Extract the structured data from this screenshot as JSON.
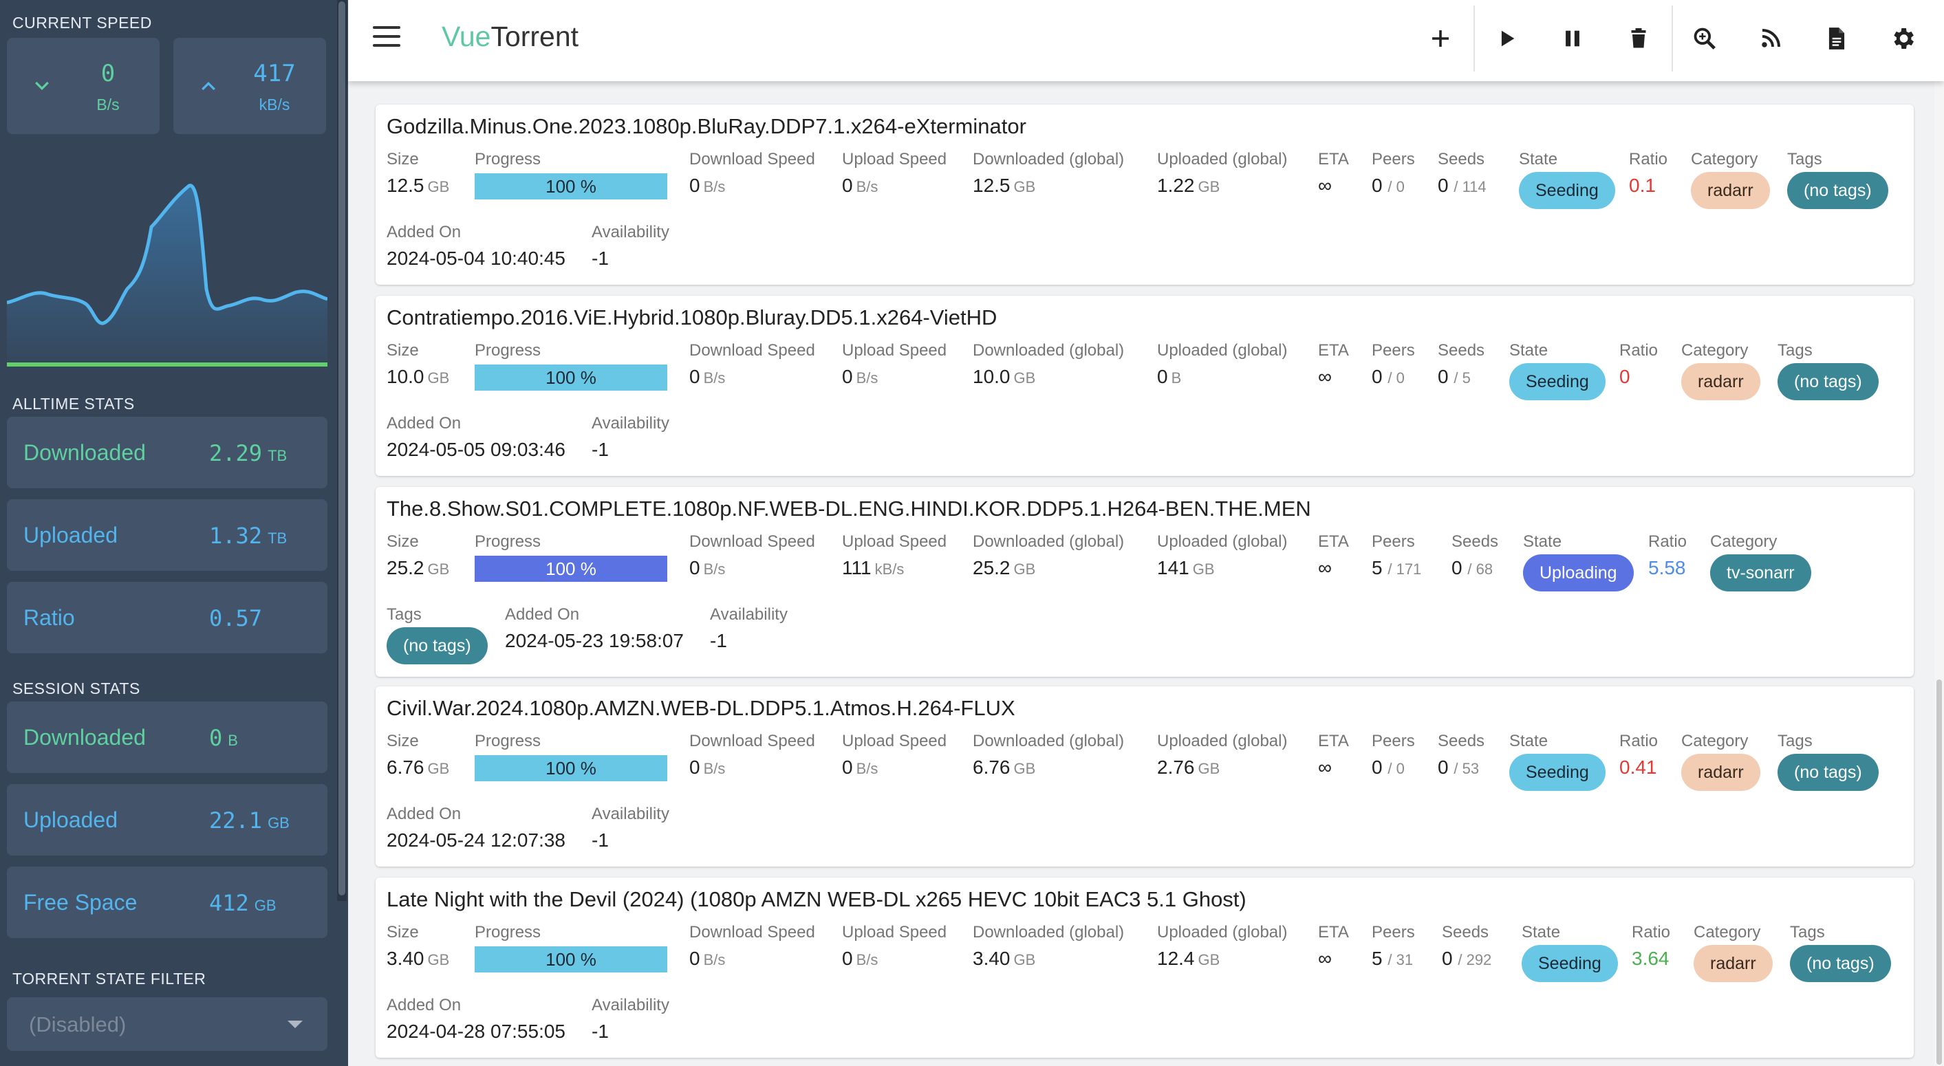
{
  "sidebar": {
    "current_speed_heading": "CURRENT SPEED",
    "download_speed": {
      "value": "0",
      "unit": "B/s"
    },
    "upload_speed": {
      "value": "417",
      "unit": "kB/s"
    },
    "alltime_heading": "ALLTIME STATS",
    "alltime": {
      "downloaded": {
        "label": "Downloaded",
        "value": "2.29",
        "unit": "TB"
      },
      "uploaded": {
        "label": "Uploaded",
        "value": "1.32",
        "unit": "TB"
      },
      "ratio": {
        "label": "Ratio",
        "value": "0.57"
      }
    },
    "session_heading": "SESSION STATS",
    "session": {
      "downloaded": {
        "label": "Downloaded",
        "value": "0",
        "unit": "B"
      },
      "uploaded": {
        "label": "Uploaded",
        "value": "22.1",
        "unit": "GB"
      },
      "free_space": {
        "label": "Free Space",
        "value": "412",
        "unit": "GB"
      }
    },
    "state_filter_heading": "TORRENT STATE FILTER",
    "state_filter_placeholder": "(Disabled)"
  },
  "topbar": {
    "title_part1": "Vue",
    "title_part2": "Torrent",
    "icons": [
      "add-icon",
      "resume-icon",
      "pause-icon",
      "delete-icon",
      "search-icon",
      "rss-icon",
      "logs-icon",
      "settings-icon"
    ]
  },
  "labels": {
    "size": "Size",
    "progress": "Progress",
    "download_speed": "Download Speed",
    "upload_speed": "Upload Speed",
    "downloaded_global": "Downloaded (global)",
    "uploaded_global": "Uploaded (global)",
    "eta": "ETA",
    "peers": "Peers",
    "seeds": "Seeds",
    "state": "State",
    "ratio": "Ratio",
    "category": "Category",
    "tags": "Tags",
    "added_on": "Added On",
    "availability": "Availability"
  },
  "torrents": [
    {
      "name": "Godzilla.Minus.One.2023.1080p.BluRay.DDP7.1.x264-eXterminator",
      "size": "12.5",
      "size_unit": "GB",
      "progress": "100 %",
      "dl_speed": "0",
      "dl_speed_unit": "B/s",
      "up_speed": "0",
      "up_speed_unit": "B/s",
      "downloaded": "12.5",
      "downloaded_unit": "GB",
      "uploaded": "1.22",
      "uploaded_unit": "GB",
      "eta": "∞",
      "peers": "0",
      "peers_total": "/ 0",
      "seeds": "0",
      "seeds_total": "/ 114",
      "state": "Seeding",
      "ratio": "0.1",
      "category": "radarr",
      "tags": "(no tags)",
      "added_on": "2024-05-04 10:40:45",
      "availability": "-1"
    },
    {
      "name": "Contratiempo.2016.ViE.Hybrid.1080p.Bluray.DD5.1.x264-VietHD",
      "size": "10.0",
      "size_unit": "GB",
      "progress": "100 %",
      "dl_speed": "0",
      "dl_speed_unit": "B/s",
      "up_speed": "0",
      "up_speed_unit": "B/s",
      "downloaded": "10.0",
      "downloaded_unit": "GB",
      "uploaded": "0",
      "uploaded_unit": "B",
      "eta": "∞",
      "peers": "0",
      "peers_total": "/ 0",
      "seeds": "0",
      "seeds_total": "/ 5",
      "state": "Seeding",
      "ratio": "0",
      "category": "radarr",
      "tags": "(no tags)",
      "added_on": "2024-05-05 09:03:46",
      "availability": "-1"
    },
    {
      "name": "The.8.Show.S01.COMPLETE.1080p.NF.WEB-DL.ENG.HINDI.KOR.DDP5.1.H264-BEN.THE.MEN",
      "size": "25.2",
      "size_unit": "GB",
      "progress": "100 %",
      "dl_speed": "0",
      "dl_speed_unit": "B/s",
      "up_speed": "111",
      "up_speed_unit": "kB/s",
      "downloaded": "25.2",
      "downloaded_unit": "GB",
      "uploaded": "141",
      "uploaded_unit": "GB",
      "eta": "∞",
      "peers": "5",
      "peers_total": "/ 171",
      "seeds": "0",
      "seeds_total": "/ 68",
      "state": "Uploading",
      "ratio": "5.58",
      "category": "tv-sonarr",
      "tags": "(no tags)",
      "added_on": "2024-05-23 19:58:07",
      "availability": "-1"
    },
    {
      "name": "Civil.War.2024.1080p.AMZN.WEB-DL.DDP5.1.Atmos.H.264-FLUX",
      "size": "6.76",
      "size_unit": "GB",
      "progress": "100 %",
      "dl_speed": "0",
      "dl_speed_unit": "B/s",
      "up_speed": "0",
      "up_speed_unit": "B/s",
      "downloaded": "6.76",
      "downloaded_unit": "GB",
      "uploaded": "2.76",
      "uploaded_unit": "GB",
      "eta": "∞",
      "peers": "0",
      "peers_total": "/ 0",
      "seeds": "0",
      "seeds_total": "/ 53",
      "state": "Seeding",
      "ratio": "0.41",
      "category": "radarr",
      "tags": "(no tags)",
      "added_on": "2024-05-24 12:07:38",
      "availability": "-1"
    },
    {
      "name": "Late Night with the Devil (2024) (1080p AMZN WEB-DL x265 HEVC 10bit EAC3 5.1 Ghost)",
      "size": "3.40",
      "size_unit": "GB",
      "progress": "100 %",
      "dl_speed": "0",
      "dl_speed_unit": "B/s",
      "up_speed": "0",
      "up_speed_unit": "B/s",
      "downloaded": "3.40",
      "downloaded_unit": "GB",
      "uploaded": "12.4",
      "uploaded_unit": "GB",
      "eta": "∞",
      "peers": "5",
      "peers_total": "/ 31",
      "seeds": "0",
      "seeds_total": "/ 292",
      "state": "Seeding",
      "ratio": "3.64",
      "category": "radarr",
      "tags": "(no tags)",
      "added_on": "2024-04-28 07:55:05",
      "availability": "-1"
    }
  ],
  "colors": {
    "ratio_low": "#e53935",
    "ratio_high": "#4caf50",
    "ratio_uploading": "#4f8ce8",
    "seeding": "#67c7e4",
    "uploading": "#5b72e2"
  }
}
